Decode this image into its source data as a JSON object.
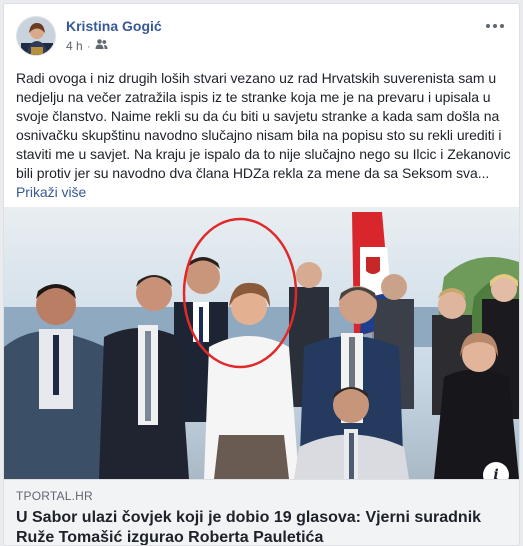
{
  "post": {
    "author": "Kristina Gogić",
    "time": "4 h",
    "audience_icon": "friends-icon",
    "more_icon": "more-options-icon",
    "text": "Radi ovoga i niz drugih loših stvari vezano uz rad Hrvatskih suverenista sam u nedjelju na večer zatražila ispis iz te stranke koja me je na prevaru i upisala u svoje članstvo. Naime rekli su da ću biti u savjetu stranke a kada sam došla na osnivačku skupštinu navodno slučajno nisam bila na popisu sto su rekli urediti i staviti me u savjet. Na kraju je ispalo da to nije slučajno nego su Ilcic i Zekanovic bili protiv jer su navodno dva člana HDZa rekla za mene da sa Seksom sva...",
    "see_more": "Prikaži više"
  },
  "link_preview": {
    "info_icon": "info-icon",
    "source": "TPORTAL.HR",
    "title": "U Sabor ulazi čovjek koji je dobio 19 glasova: Vjerni suradnik Ruže Tomašić izgurao Roberta Pauletića"
  },
  "colors": {
    "link_blue": "#385898",
    "text": "#1d2129",
    "meta": "#616770",
    "highlight_circle": "#e02a2a",
    "link_box_bg": "#f2f3f5"
  }
}
